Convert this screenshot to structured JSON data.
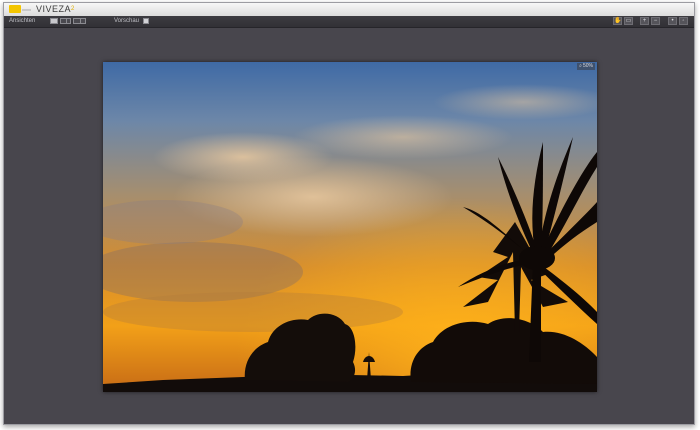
{
  "app": {
    "name": "VIVEZA",
    "version": "2"
  },
  "toolbar": {
    "view_label": "Ansichten",
    "preview_label": "Vorschau",
    "preview_checked": true,
    "view_modes": [
      "single-view-icon",
      "split-view-icon",
      "side-by-side-view-icon"
    ],
    "active_view": "single-view-icon",
    "tools": [
      "hand-tool-icon",
      "selection-tool-icon",
      "zoom-in-icon",
      "zoom-out-icon",
      "add-point-icon",
      "remove-point-icon"
    ]
  },
  "image": {
    "zoom_label": "50%"
  },
  "colors": {
    "accent": "#f3c500",
    "canvas_bg": "#48464d"
  }
}
